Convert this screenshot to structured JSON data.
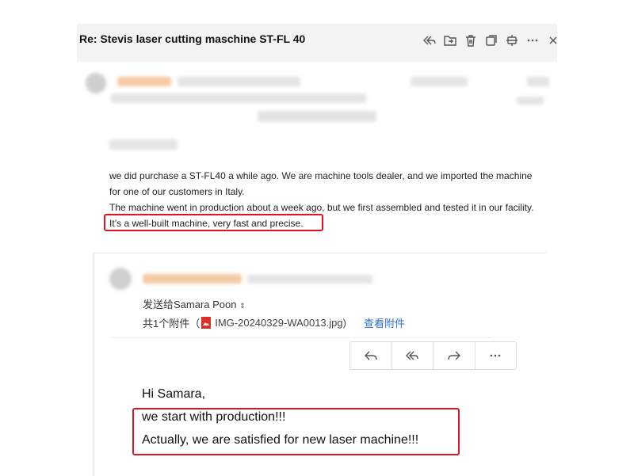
{
  "email": {
    "subject": "Re: Stevis laser cutting maschine ST-FL 40"
  },
  "toolbar_icons": [
    "reply-all-icon",
    "move-folder-icon",
    "trash-icon",
    "copy-icon",
    "pin-icon",
    "more-icon",
    "close-icon"
  ],
  "reply_body": [
    "we did purchase a ST-FL40 a while ago. We are machine tools dealer, and we imported the machine",
    "for one of our customers in Italy.",
    "The machine went in production about a week ago, but we first assembled and tested it in our facility.",
    "It’s a well-built machine, very fast and precise."
  ],
  "quoted": {
    "recipient_line": "发送给Samara Poon",
    "attachments_prefix": "共1个附件（",
    "attachment_name": "IMG-20240329-WA0013.jpg)",
    "view_attachments_label": "查看附件",
    "greeting": "Hi Samara,",
    "lines": [
      "we start with production!!!",
      "Actually, we are satisfied for new laser machine!!!"
    ]
  },
  "colors": {
    "highlight_box": "#e0141e",
    "link": "#2f6fd1",
    "header_bg": "#f3f3f3"
  }
}
